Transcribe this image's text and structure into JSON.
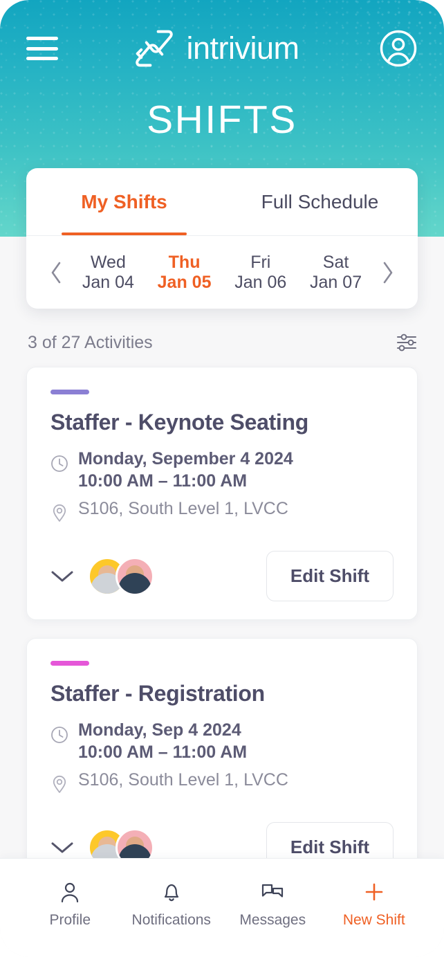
{
  "brand": {
    "name": "intrivium",
    "logo_icon": "intrivium-mark-icon",
    "header_gradient_from": "#12a5c0",
    "header_gradient_to": "#63d6cb",
    "accent_orange": "#ef6024"
  },
  "header": {
    "menu_icon": "hamburger-menu-icon",
    "account_icon": "user-account-icon",
    "page_title": "SHIFTS"
  },
  "tabs": [
    {
      "label": "My Shifts",
      "active": true
    },
    {
      "label": "Full Schedule",
      "active": false
    }
  ],
  "datestrip": {
    "prev_icon": "chevron-left-icon",
    "next_icon": "chevron-right-icon",
    "days": [
      {
        "dow": "Wed",
        "dom": "Jan 04",
        "active": false
      },
      {
        "dow": "Thu",
        "dom": "Jan 05",
        "active": true
      },
      {
        "dow": "Fri",
        "dom": "Jan 06",
        "active": false
      },
      {
        "dow": "Sat",
        "dom": "Jan 07",
        "active": false
      }
    ]
  },
  "activities": {
    "count_label": "3 of 27 Activities",
    "filter_icon": "filter-sliders-icon"
  },
  "shift_cards": [
    {
      "accent_color": "#8b7fd4",
      "title": "Staffer - Keynote Seating",
      "clock_icon": "clock-icon",
      "date": "Monday, Sepember 4 2024",
      "time": "10:00 AM – 11:00 AM",
      "location_icon": "location-pin-icon",
      "location": "S106, South Level 1, LVCC",
      "expand_icon": "chevron-down-icon",
      "avatars": [
        {
          "bg": "#fdc82a",
          "skin": "#e8b894",
          "shirt": "#cfd3d8"
        },
        {
          "bg": "#f4afb6",
          "skin": "#e0aa86",
          "shirt": "#2f4256"
        }
      ],
      "edit_label": "Edit Shift"
    },
    {
      "accent_color": "#e557d8",
      "title": "Staffer - Registration",
      "clock_icon": "clock-icon",
      "date": "Monday, Sep 4 2024",
      "time": "10:00 AM – 11:00 AM",
      "location_icon": "location-pin-icon",
      "location": "S106, South Level 1, LVCC",
      "expand_icon": "chevron-down-icon",
      "avatars": [
        {
          "bg": "#fdc82a",
          "skin": "#e8b894",
          "shirt": "#cfd3d8"
        },
        {
          "bg": "#f4afb6",
          "skin": "#e0aa86",
          "shirt": "#2f4256"
        }
      ],
      "edit_label": "Edit Shift"
    }
  ],
  "bottom_nav": [
    {
      "label": "Profile",
      "icon": "person-icon",
      "accent": false
    },
    {
      "label": "Notifications",
      "icon": "bell-icon",
      "accent": false
    },
    {
      "label": "Messages",
      "icon": "chat-bubbles-icon",
      "accent": false
    },
    {
      "label": "New Shift",
      "icon": "plus-icon",
      "accent": true
    }
  ]
}
